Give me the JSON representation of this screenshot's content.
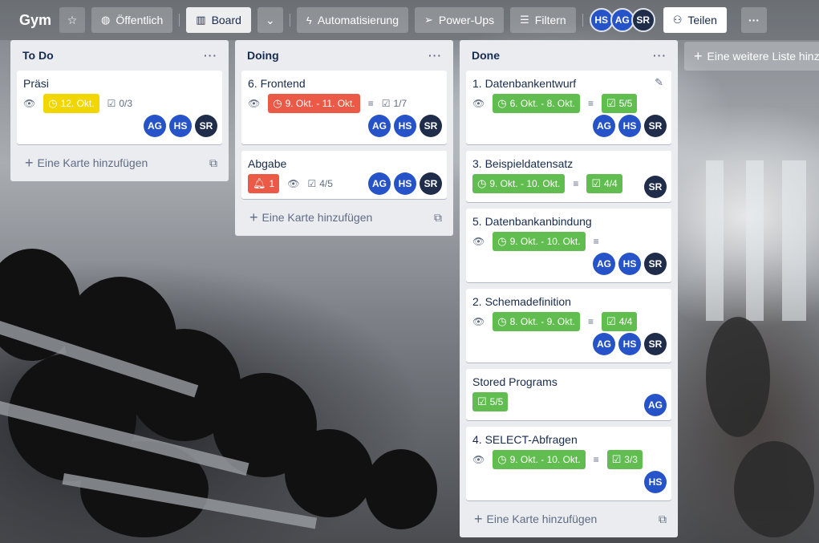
{
  "header": {
    "board_name": "Gym",
    "visibility": "Öffentlich",
    "view": "Board",
    "automation": "Automatisierung",
    "powerups": "Power-Ups",
    "filter": "Filtern",
    "members": [
      "HS",
      "AG",
      "SR"
    ],
    "share": "Teilen"
  },
  "lists": [
    {
      "title": "To Do",
      "add_card": "Eine Karte hinzufügen",
      "cards": [
        {
          "title": "Präsi",
          "due": "12. Okt.",
          "checklist": "0/3",
          "members": [
            "AG",
            "HS",
            "SR"
          ]
        }
      ]
    },
    {
      "title": "Doing",
      "add_card": "Eine Karte hinzufügen",
      "cards": [
        {
          "title": "6. Frontend",
          "due": "9. Okt. - 11. Okt.",
          "checklist": "1/7",
          "members": [
            "AG",
            "HS",
            "SR"
          ]
        },
        {
          "title": "Abgabe",
          "notifications": "1",
          "checklist": "4/5",
          "members": [
            "AG",
            "HS",
            "SR"
          ]
        }
      ]
    },
    {
      "title": "Done",
      "add_card": "Eine Karte hinzufügen",
      "cards": [
        {
          "title": "1. Datenbankentwurf",
          "due": "6. Okt. - 8. Okt.",
          "checklist": "5/5",
          "members": [
            "AG",
            "HS",
            "SR"
          ]
        },
        {
          "title": "3. Beispieldatensatz",
          "due": "9. Okt. - 10. Okt.",
          "checklist": "4/4",
          "members": [
            "SR"
          ]
        },
        {
          "title": "5. Datenbankanbindung",
          "due": "9. Okt. - 10. Okt.",
          "members": [
            "AG",
            "HS",
            "SR"
          ]
        },
        {
          "title": "2. Schemadefinition",
          "due": "8. Okt. - 9. Okt.",
          "checklist": "4/4",
          "members": [
            "AG",
            "HS",
            "SR"
          ]
        },
        {
          "title": "Stored Programs",
          "checklist": "5/5",
          "members": [
            "AG"
          ]
        },
        {
          "title": "4. SELECT-Abfragen",
          "due": "9. Okt. - 10. Okt.",
          "checklist": "3/3",
          "members": [
            "HS"
          ]
        }
      ]
    }
  ],
  "add_list": "Eine weitere Liste hinzufügen",
  "colors": {
    "due_yellow": "#f2d600",
    "due_red": "#eb5a46",
    "complete_green": "#61bd4f",
    "avatar_blue": "#2753c9",
    "avatar_dark": "#1f2c4a"
  }
}
